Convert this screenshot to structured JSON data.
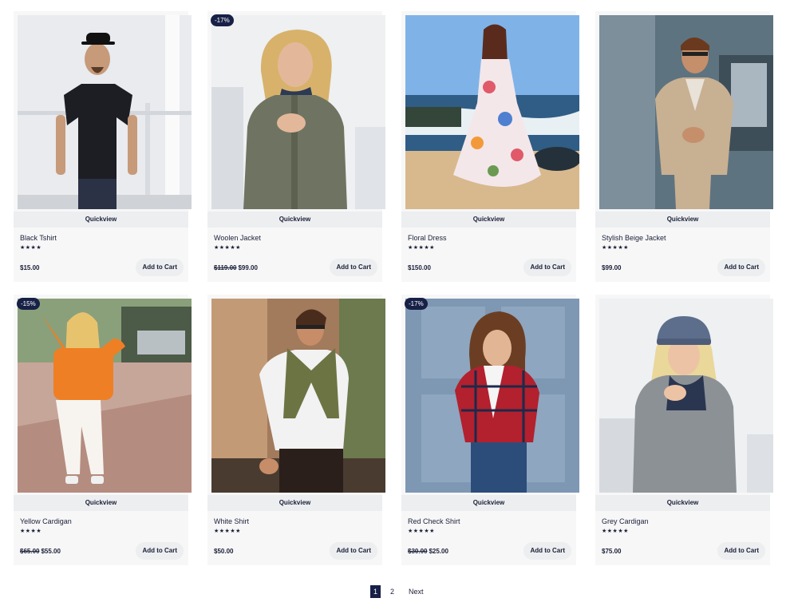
{
  "quickview_label": "Quickview",
  "add_to_cart_label": "Add to Cart",
  "products": [
    {
      "name": "Black Tshirt",
      "rating": 4,
      "stars": "★★★★",
      "price": "$15.00",
      "old_price": "",
      "badge": ""
    },
    {
      "name": "Woolen Jacket",
      "rating": 5,
      "stars": "★★★★★",
      "price": "$99.00",
      "old_price": "$119.00",
      "badge": "-17%"
    },
    {
      "name": "Floral Dress",
      "rating": 5,
      "stars": "★★★★★",
      "price": "$150.00",
      "old_price": "",
      "badge": ""
    },
    {
      "name": "Stylish Beige Jacket",
      "rating": 5,
      "stars": "★★★★★",
      "price": "$99.00",
      "old_price": "",
      "badge": ""
    },
    {
      "name": "Yellow Cardigan",
      "rating": 4,
      "stars": "★★★★",
      "price": "$55.00",
      "old_price": "$65.00",
      "badge": "-15%"
    },
    {
      "name": "White Shirt",
      "rating": 5,
      "stars": "★★★★★",
      "price": "$50.00",
      "old_price": "",
      "badge": ""
    },
    {
      "name": "Red Check Shirt",
      "rating": 5,
      "stars": "★★★★★",
      "price": "$25.00",
      "old_price": "$30.00",
      "badge": "-17%"
    },
    {
      "name": "Grey Cardigan",
      "rating": 5,
      "stars": "★★★★★",
      "price": "$75.00",
      "old_price": "",
      "badge": ""
    }
  ],
  "pagination": {
    "pages": [
      "1",
      "2"
    ],
    "current": "1",
    "next_label": "Next"
  },
  "colors": {
    "accent": "#172046",
    "card_bg": "#f7f7f8",
    "button_bg": "#eceef0"
  }
}
